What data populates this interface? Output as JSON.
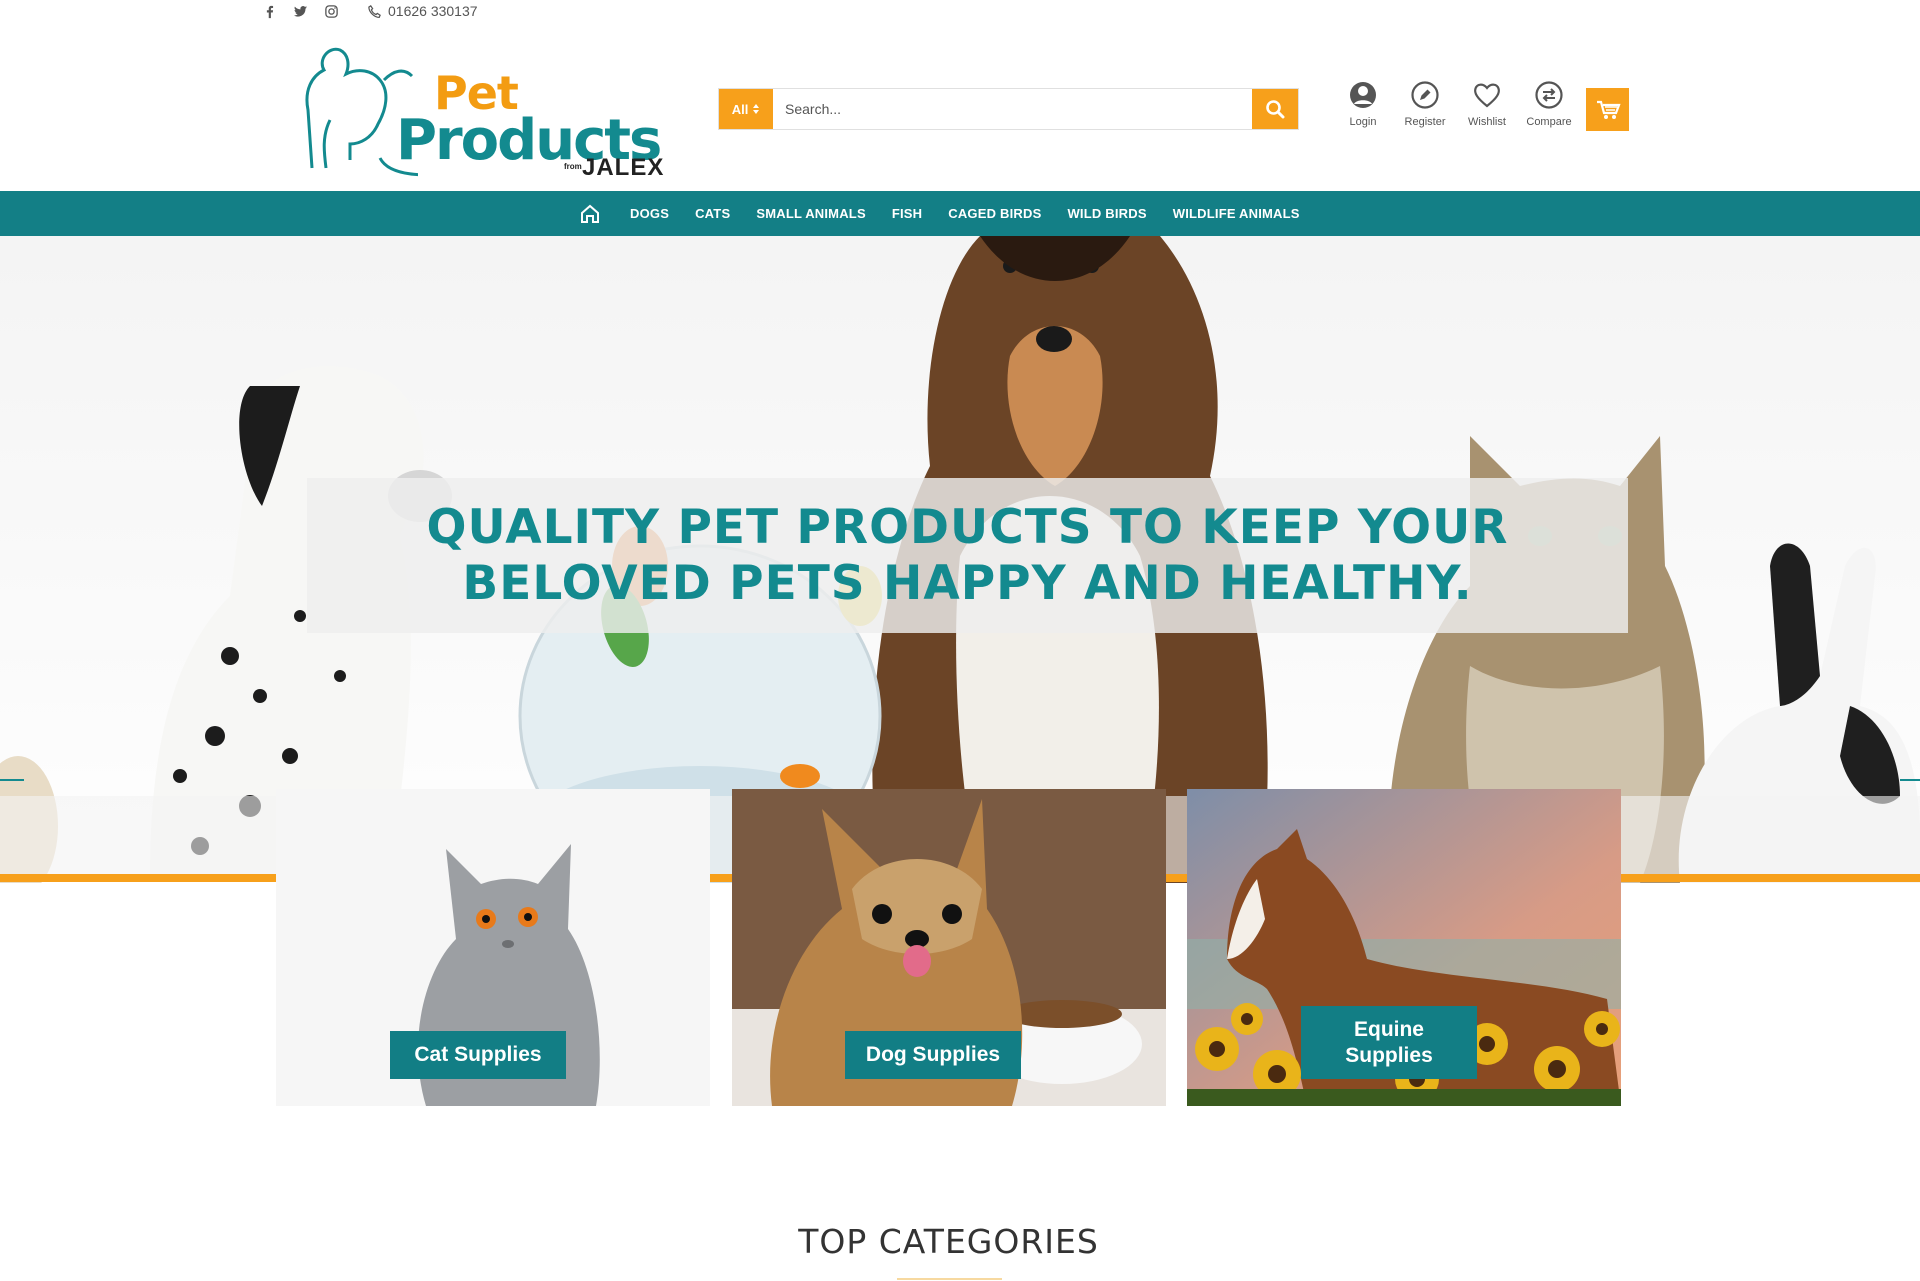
{
  "topbar": {
    "phone": "01626 330137"
  },
  "logo": {
    "line1": "Pet",
    "line2": "Products",
    "from": "from",
    "brand": "JALEX"
  },
  "search": {
    "category": "All",
    "placeholder": "Search..."
  },
  "account": [
    {
      "label": "Login",
      "icon": "user-icon"
    },
    {
      "label": "Register",
      "icon": "pencil-icon"
    },
    {
      "label": "Wishlist",
      "icon": "heart-icon"
    },
    {
      "label": "Compare",
      "icon": "compare-icon"
    }
  ],
  "nav": [
    "DOGS",
    "CATS",
    "SMALL ANIMALS",
    "FISH",
    "CAGED BIRDS",
    "WILD BIRDS",
    "WILDLIFE ANIMALS"
  ],
  "hero": {
    "line1": "QUALITY PET PRODUCTS TO KEEP YOUR",
    "line2": "BELOVED PETS HAPPY AND HEALTHY."
  },
  "cards": [
    {
      "label": "Cat Supplies"
    },
    {
      "label": "Dog Supplies"
    },
    {
      "label": "Equine Supplies"
    }
  ],
  "section": {
    "title": "TOP CATEGORIES"
  },
  "colors": {
    "teal": "#137f86",
    "orange": "#f7a01b"
  }
}
